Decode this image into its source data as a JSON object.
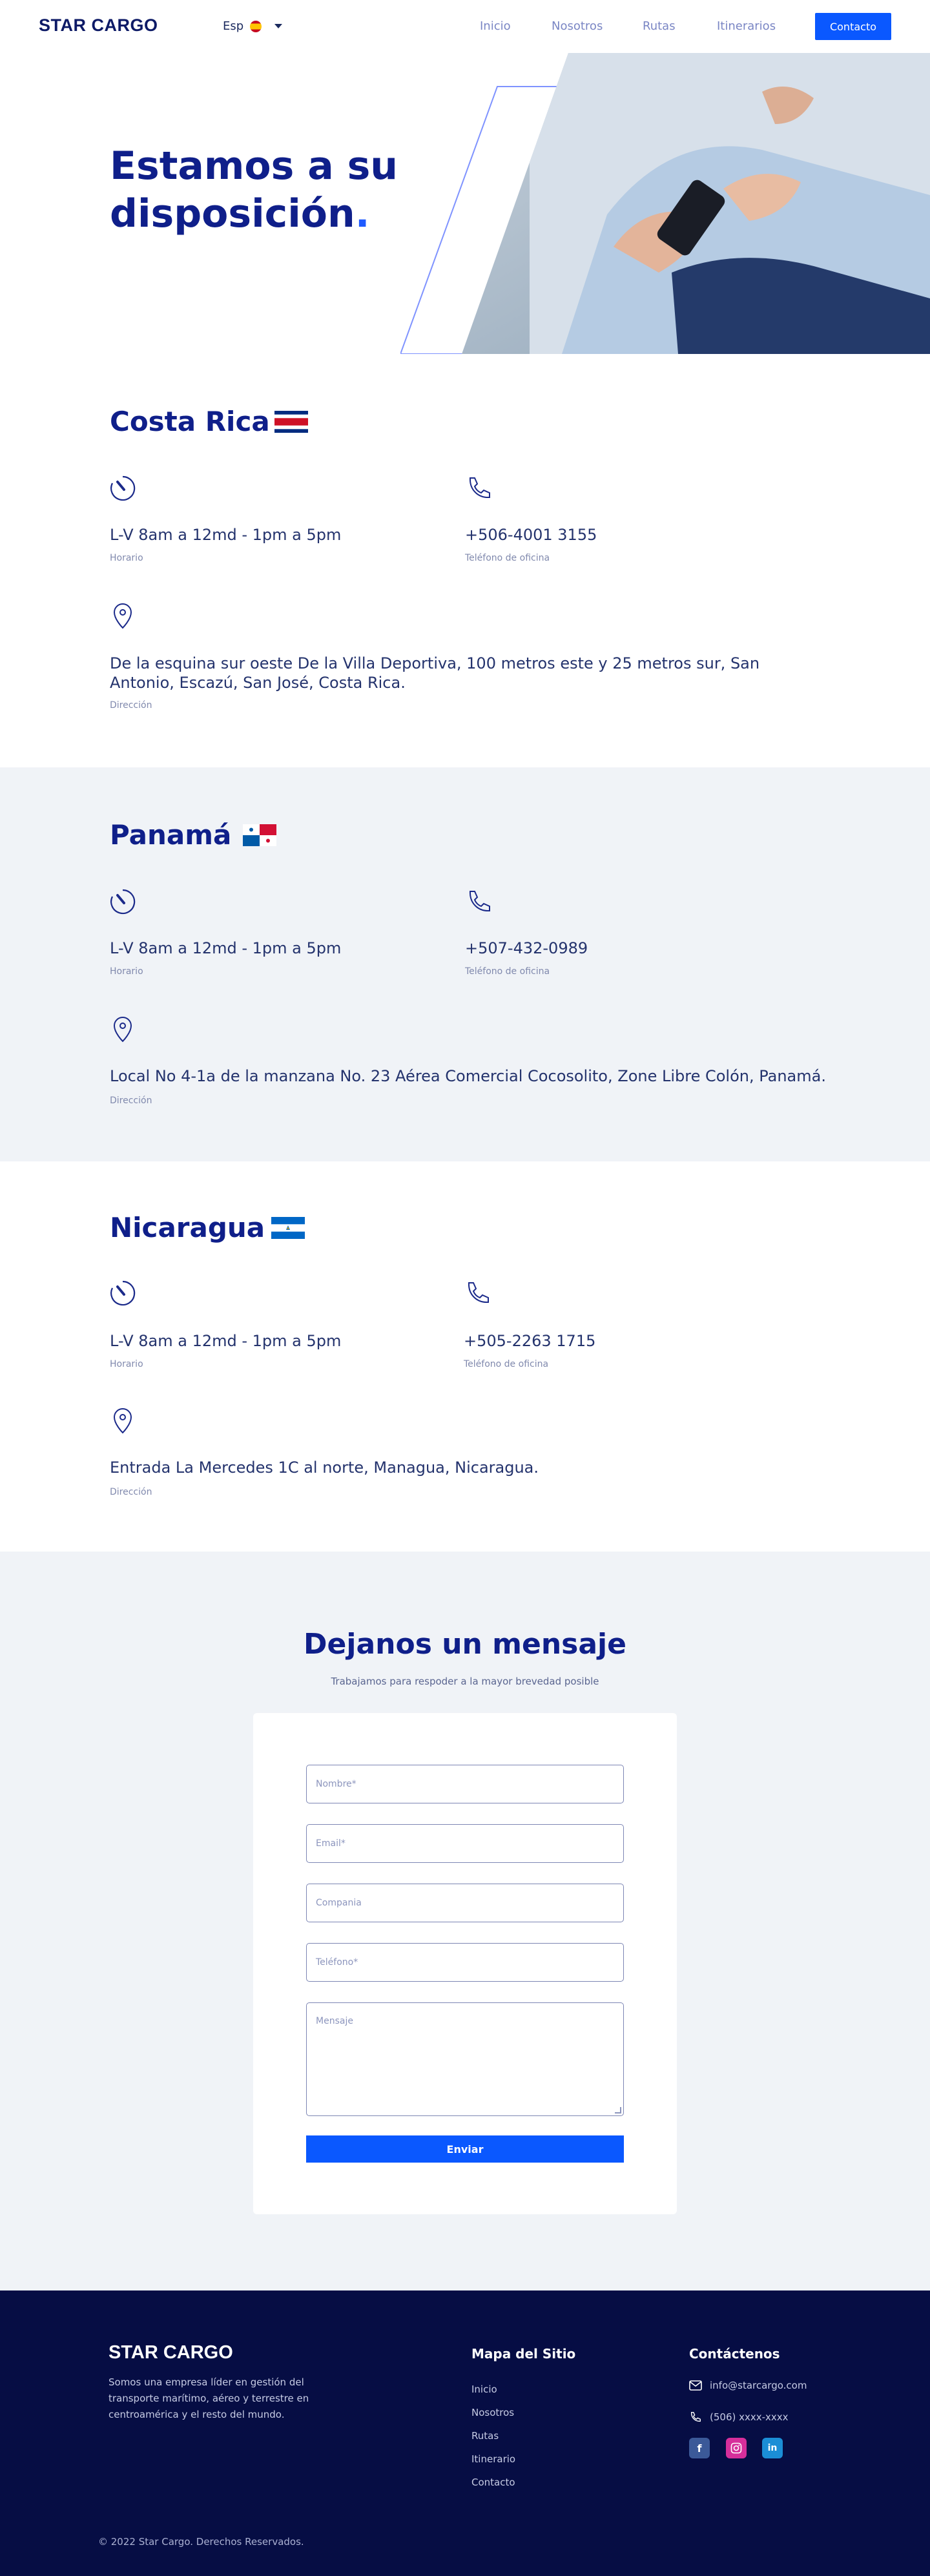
{
  "header": {
    "logo": "STAR CARGO",
    "language": "Esp",
    "nav": [
      "Inicio",
      "Nosotros",
      "Rutas",
      "Itinerarios"
    ],
    "cta": "Contacto"
  },
  "hero": {
    "title_line1": "Estamos a su",
    "title_line2": "disposición",
    "title_dot": "."
  },
  "offices": [
    {
      "country": "Costa Rica",
      "hours": "L-V 8am a 12md - 1pm a 5pm",
      "hours_label": "Horario",
      "phone": "+506-4001 3155",
      "phone_label": "Teléfono de oficina",
      "address": "De la esquina sur oeste De la Villa Deportiva, 100 metros este y 25 metros sur, San Antonio, Escazú, San José, Costa Rica.",
      "address_label": "Dirección"
    },
    {
      "country": "Panamá",
      "hours": "L-V 8am a 12md - 1pm a 5pm",
      "hours_label": "Horario",
      "phone": "+507-432-0989",
      "phone_label": "Teléfono de oficina",
      "address": "Local No 4-1a de la manzana No. 23 Aérea Comercial Cocosolito, Zone Libre Colón, Panamá.",
      "address_label": "Dirección"
    },
    {
      "country": "Nicaragua",
      "hours": "L-V 8am a 12md - 1pm a 5pm",
      "hours_label": "Horario",
      "phone": "+505-2263 1715",
      "phone_label": "Teléfono de oficina",
      "address": "Entrada La Mercedes 1C al norte, Managua, Nicaragua.",
      "address_label": "Dirección"
    }
  ],
  "form": {
    "title": "Dejanos un mensaje",
    "subtitle": "Trabajamos para respoder a la mayor brevedad posible",
    "placeholders": [
      "Nombre*",
      "Email*",
      "Compania",
      "Teléfono*",
      "Mensaje"
    ],
    "submit": "Enviar"
  },
  "footer": {
    "logo": "STAR CARGO",
    "description": "Somos una empresa líder en gestión del transporte marítimo, aéreo y terrestre en centroamérica y el resto del mundo.",
    "sitemap_title": "Mapa del Sitio",
    "sitemap_links": [
      "Inicio",
      "Nosotros",
      "Rutas",
      "Itinerario",
      "Contacto"
    ],
    "contact_title": "Contáctenos",
    "email": "info@starcargo.com",
    "phone": "(506) xxxx-xxxx",
    "social": [
      "f",
      "ig",
      "in"
    ],
    "copyright": "© 2022 Star Cargo. Derechos Reservados."
  },
  "colors": {
    "primary": "#0a58ff",
    "navy": "#0f1f8a",
    "footer_bg": "#060d44",
    "section_alt_bg": "#f0f3f7"
  }
}
